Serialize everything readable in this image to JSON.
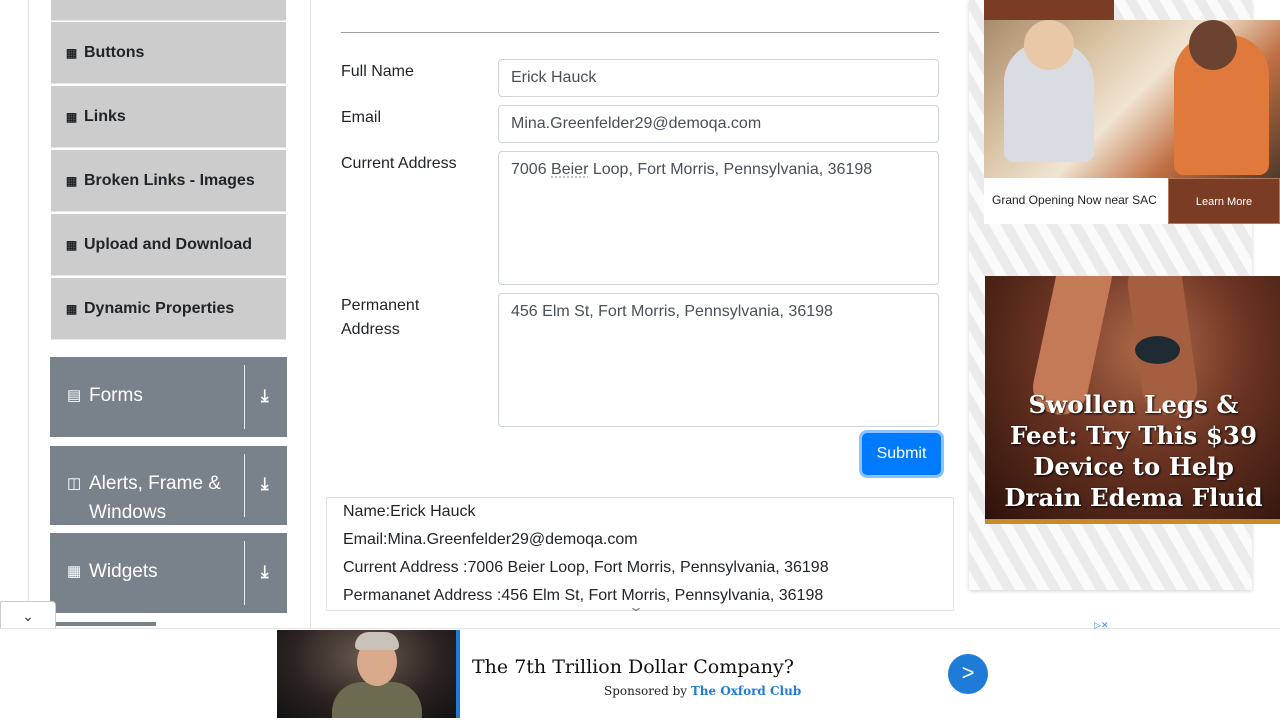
{
  "sidebar": {
    "elements_items": [
      {
        "label": "Buttons",
        "icon": "html5-icon"
      },
      {
        "label": "Links",
        "icon": "html5-icon"
      },
      {
        "label": "Broken Links - Images",
        "icon": "html5-icon"
      },
      {
        "label": "Upload and Download",
        "icon": "html5-icon"
      },
      {
        "label": "Dynamic Properties",
        "icon": "html5-icon"
      }
    ],
    "groups": [
      {
        "label": "Forms",
        "icon": "form-icon"
      },
      {
        "label": "Alerts, Frame & Windows",
        "icon": "window-icon"
      },
      {
        "label": "Widgets",
        "icon": "widgets-icon"
      }
    ]
  },
  "form": {
    "full_name_label": "Full Name",
    "full_name_value": "Erick Hauck",
    "email_label": "Email",
    "email_value": "Mina.Greenfelder29@demoqa.com",
    "current_address_label": "Current Address",
    "current_address_parts": [
      "7006 ",
      "Beier",
      " Loop, Fort Morris, Pennsylvania, 36198"
    ],
    "permanent_address_label": "Permanent Address",
    "permanent_address_value": "456 Elm St, Fort Morris, Pennsylvania, 36198",
    "submit_label": "Submit"
  },
  "output": {
    "name": "Name:Erick Hauck",
    "email": "Email:Mina.Greenfelder29@demoqa.com",
    "current_address": "Current Address :7006 Beier Loop, Fort Morris, Pennsylvania, 36198",
    "permanent_address": "Permananet Address :456 Elm St, Fort Morris, Pennsylvania, 36198"
  },
  "ads": {
    "ad1_caption": "Grand Opening Now near SAC",
    "ad1_button": "Learn More",
    "ad2_headline": "Swollen Legs & Feet: Try This $39 Device to Help Drain Edema Fluid",
    "bottom_headline": "The 7th Trillion Dollar Company?",
    "bottom_sponsor_prefix": "Sponsored by ",
    "bottom_sponsor_name": "The Oxford Club",
    "bottom_go": ">"
  },
  "colors": {
    "sidebar_item_bg": "#cccccc",
    "group_bg": "#79828b",
    "submit_bg": "#007bff",
    "ad_accent": "#1e7bd8"
  }
}
